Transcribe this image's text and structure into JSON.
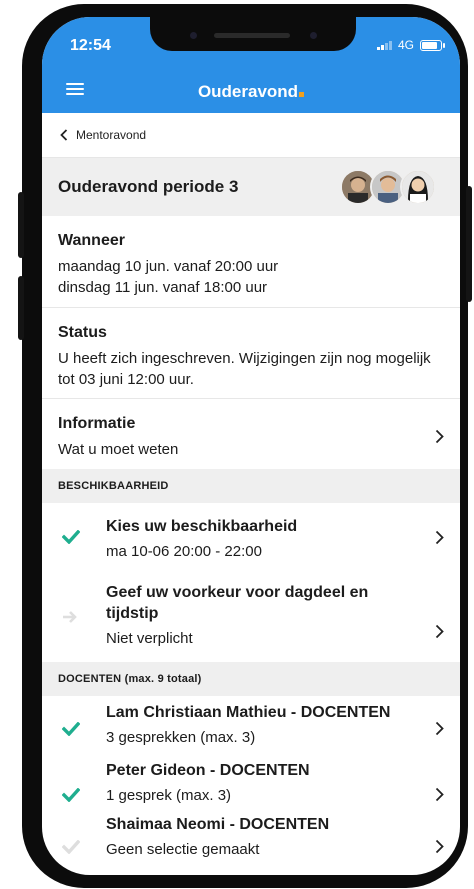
{
  "status_bar": {
    "time": "12:54",
    "network": "4G",
    "battery_level": 0.75
  },
  "header": {
    "title": "Ouderavond",
    "menu_icon": "hamburger-menu-icon",
    "background_color": "#2b8fe6",
    "accent_color": "#f0a020"
  },
  "breadcrumb": {
    "back_label": "Mentoravond",
    "back_icon": "chevron-left-icon"
  },
  "event": {
    "title": "Ouderavond periode 3",
    "avatar_count": 3
  },
  "wanneer": {
    "title": "Wanneer",
    "lines": [
      "maandag 10 jun. vanaf 20:00 uur",
      "dinsdag 11 jun. vanaf 18:00 uur"
    ]
  },
  "status": {
    "title": "Status",
    "text": "U heeft zich ingeschreven. Wijzigingen zijn nog mogelijk tot 03 juni 12:00 uur."
  },
  "informatie": {
    "title": "Informatie",
    "subtitle": "Wat u moet weten"
  },
  "beschikbaarheid": {
    "header": "BESCHIKBAARHEID",
    "items": [
      {
        "title": "Kies uw beschikbaarheid",
        "subtitle": "ma 10-06 20:00 - 22:00",
        "icon": "check-icon"
      },
      {
        "title": "Geef uw voorkeur voor dagdeel en tijdstip",
        "subtitle": "Niet verplicht",
        "icon": "arrow-right-icon"
      }
    ]
  },
  "docenten": {
    "header": "DOCENTEN (max. 9 totaal)",
    "items": [
      {
        "title": "Lam Christiaan Mathieu - DOCENTEN",
        "subtitle": "3 gesprekken (max. 3)",
        "icon": "check-icon"
      },
      {
        "title": "Peter Gideon  - DOCENTEN",
        "subtitle": "1 gesprek (max. 3)",
        "icon": "check-icon"
      },
      {
        "title": "Shaimaa Neomi  - DOCENTEN",
        "subtitle": "Geen selectie gemaakt",
        "icon": "check-icon"
      }
    ]
  },
  "colors": {
    "check_active": "#1fae8f",
    "check_inactive": "#dedede",
    "section_background": "#efefef"
  }
}
